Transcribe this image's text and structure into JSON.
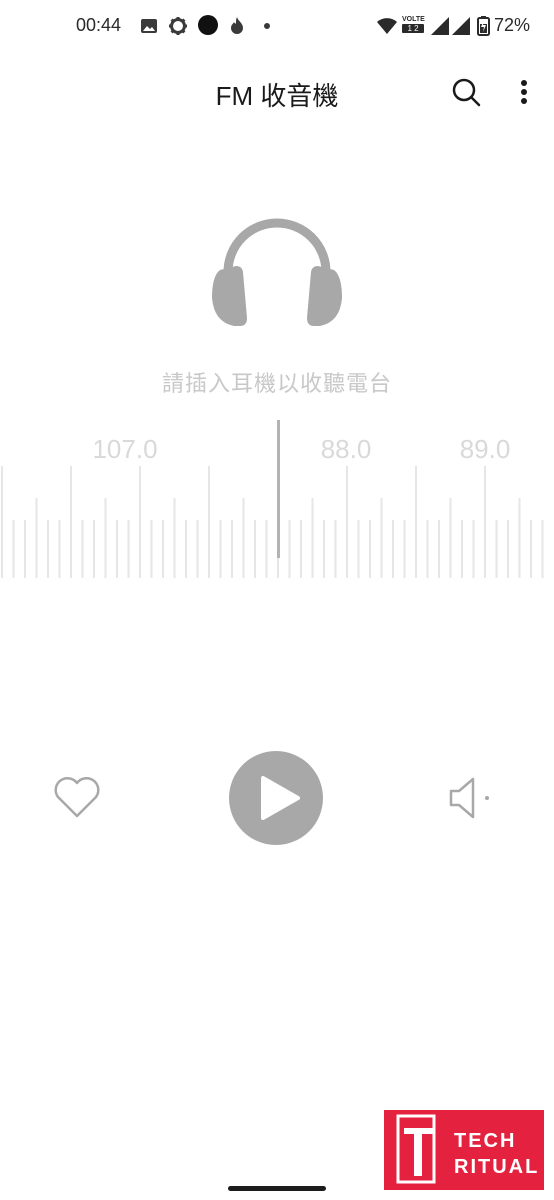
{
  "status_bar": {
    "time": "00:44",
    "battery": "72%",
    "network_badge_top": "VOLTE",
    "network_badge_bottom": "1 2",
    "icons": [
      "image-icon",
      "gear-icon",
      "record-dot-icon",
      "flame-icon",
      "dot-icon",
      "wifi-icon",
      "volte-icon",
      "signal-icon",
      "signal-icon",
      "battery-icon"
    ]
  },
  "toolbar": {
    "title": "FM 收音機",
    "icons": [
      "search-icon",
      "more-vert-icon"
    ]
  },
  "main": {
    "hint": "請插入耳機以收聽電台",
    "dial_labels": [
      "107.0",
      "88.0",
      "89.0"
    ]
  },
  "controls": {
    "icons": [
      "heart-icon",
      "play-icon",
      "volume-icon"
    ]
  },
  "watermark": {
    "line1": "TECH",
    "line2": "RITUAL"
  },
  "colors": {
    "grey_icon": "#a8a8a8",
    "tick": "#e6e6e6",
    "needle": "#b3b3b3",
    "watermark": "#e4223f"
  }
}
